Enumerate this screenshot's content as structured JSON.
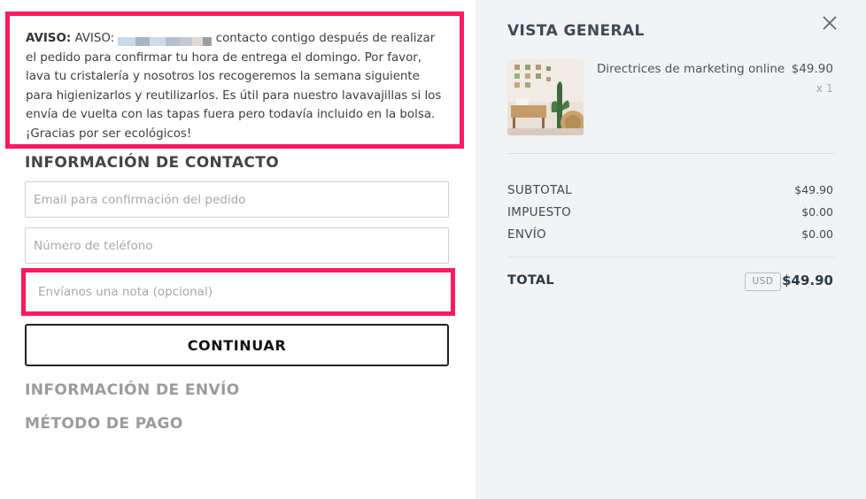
{
  "notice": {
    "bold_label": "AVISO:",
    "prefix": "AVISO:",
    "text": "contacto contigo después de realizar el pedido para confirmar tu hora de entrega el domingo. Por favor, lava tu cristalería y nosotros los recogeremos la semana siguiente para higienizarlos y reutilizarlos. Es útil para nuestro lavavajillas si los envía de vuelta con las tapas fuera pero todavía incluido en la bolsa. ¡Gracias por ser ecológicos!",
    "highlight_color": "#ff1a5e"
  },
  "contact": {
    "title": "INFORMACIÓN DE CONTACTO",
    "email_placeholder": "Email para confirmación del pedido",
    "phone_placeholder": "Número de teléfono",
    "note_placeholder": "Envíanos una nota (opcional)"
  },
  "continue_label": "CONTINUAR",
  "shipping_title": "INFORMACIÓN DE ENVÍO",
  "payment_title": "MÉTODO DE PAGO",
  "summary": {
    "title": "VISTA GENERAL",
    "close_icon": "close-icon",
    "product": {
      "name": "Directrices de marketing online",
      "price": "$49.90",
      "quantity": "x 1",
      "image_icon": "product-photo"
    },
    "subtotal_label": "SUBTOTAL",
    "subtotal_value": "$49.90",
    "tax_label": "IMPUESTO",
    "tax_value": "$0.00",
    "shipping_label": "ENVÍO",
    "shipping_value": "$0.00",
    "total_label": "TOTAL",
    "currency": "USD",
    "total_value": "$49.90"
  }
}
